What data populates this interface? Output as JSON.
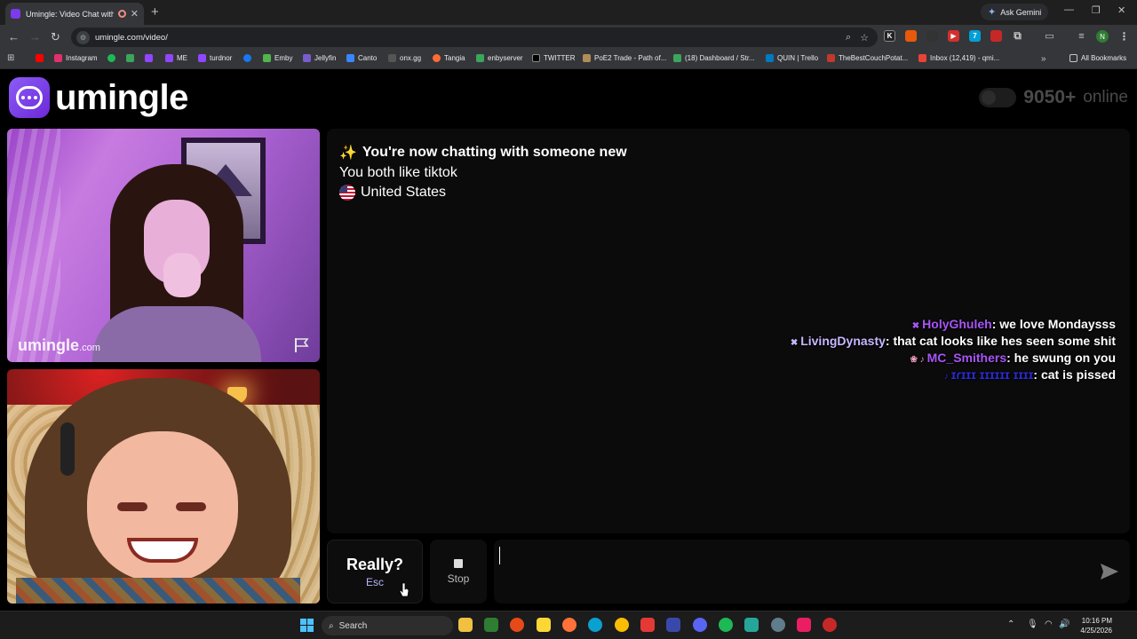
{
  "browser": {
    "tab_title": "Umingle: Video Chat with S",
    "ask_gemini": "Ask Gemini",
    "url": "umingle.com/video/",
    "profile_initial": "N",
    "bookmarks": [
      {
        "label": "Instagram",
        "color": "#e1306c"
      },
      {
        "label": "",
        "color": "#1db954"
      },
      {
        "label": "",
        "color": "#3ba55d"
      },
      {
        "label": "",
        "color": "#9146ff"
      },
      {
        "label": "ME",
        "color": "#9146ff"
      },
      {
        "label": "turdnor",
        "color": "#9146ff"
      },
      {
        "label": "",
        "color": "#1877f2"
      },
      {
        "label": "Emby",
        "color": "#52b54b"
      },
      {
        "label": "Jellyfin",
        "color": "#7a5ccc"
      },
      {
        "label": "Canto",
        "color": "#3a86ff"
      },
      {
        "label": "onx.gg",
        "color": "#555555"
      },
      {
        "label": "Tangia",
        "color": "#ff6b35"
      },
      {
        "label": "enbyserver",
        "color": "#3ba55d"
      },
      {
        "label": "TWITTER",
        "color": "#000000"
      },
      {
        "label": "PoE2 Trade - Path of...",
        "color": "#b08d57"
      },
      {
        "label": "(18) Dashboard / Str...",
        "color": "#3ba55d"
      },
      {
        "label": "QUIN | Trello",
        "color": "#0079bf"
      },
      {
        "label": "TheBestCouchPotat...",
        "color": "#c0392b"
      },
      {
        "label": "Inbox (12,419) - qmi...",
        "color": "#ea4335"
      }
    ],
    "all_bookmarks": "All Bookmarks"
  },
  "site": {
    "logo_text": "umingle",
    "online_count": "9050+",
    "online_word": "online",
    "watermark": "umingle",
    "watermark_suffix": ".com"
  },
  "chat": {
    "intro": "You're now chatting with someone new",
    "shared_interest": "You both like tiktok",
    "country": "United States",
    "overlay": [
      {
        "badge": "✖",
        "name": "HolyGhuleh",
        "name_color": "#a855f7",
        "message": ": we love Mondaysss"
      },
      {
        "badge": "✖",
        "name": "LivingDynasty",
        "name_color": "#c8b8ff",
        "message": ": that cat looks like hes seen some shit"
      },
      {
        "badge": "❀ ♪",
        "name": "MC_Smithers",
        "name_color": "#a855f7",
        "message": ": he swung on you"
      },
      {
        "badge": "♪",
        "name": "ɪɾɪɪɪ ɪɪɪɪɪɪ ɪɪɪɪ",
        "name_color": "#2b2bd6",
        "message": ": cat is pissed"
      }
    ]
  },
  "controls": {
    "skip_label": "Really?",
    "skip_hint": "Esc",
    "stop_label": "Stop",
    "message_placeholder": ""
  },
  "taskbar": {
    "search_label": "Search",
    "time": "10:16 PM",
    "date": "4/25/2026"
  }
}
